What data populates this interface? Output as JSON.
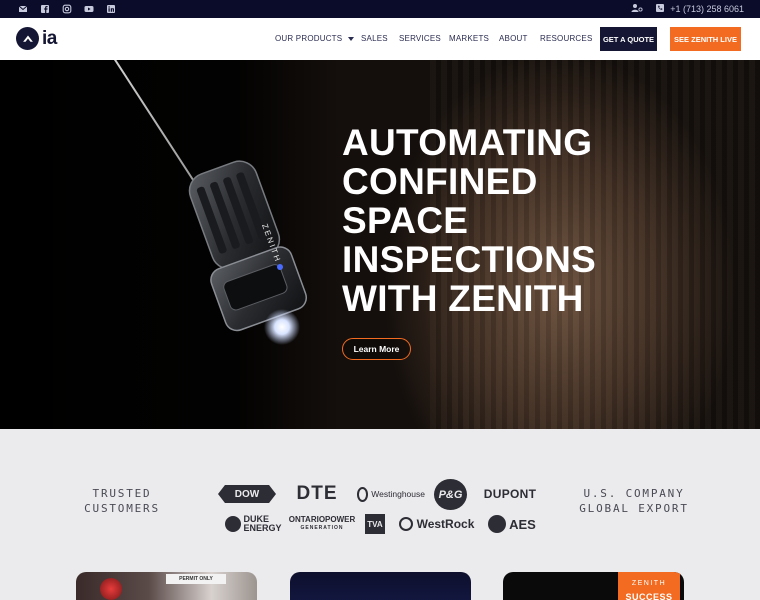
{
  "topbar": {
    "social": [
      "envelope-icon",
      "facebook-icon",
      "instagram-icon",
      "youtube-icon",
      "linkedin-icon"
    ],
    "phone": "+1 (713) 258 6061"
  },
  "nav": {
    "logo_text": "ia",
    "menu": [
      "OUR PRODUCTS",
      "SALES",
      "SERVICES",
      "MARKETS",
      "ABOUT",
      "RESOURCES"
    ],
    "quote_label": "GET A QUOTE",
    "live_label": "SEE ZENITH LIVE"
  },
  "hero": {
    "headline_lines": [
      "AUTOMATING",
      "CONFINED",
      "SPACE",
      "INSPECTIONS",
      "WITH ZENITH"
    ],
    "device_label": "ZENITH",
    "cta_label": "Learn More"
  },
  "trusted": {
    "left_label_lines": [
      "TRUSTED",
      "CUSTOMERS"
    ],
    "right_label_lines": [
      "U.S. COMPANY",
      "GLOBAL EXPORT"
    ],
    "brands_row1": [
      "DOW",
      "DTE",
      "Westinghouse",
      "P&G",
      "DUPONT"
    ],
    "brands_row2": [
      "DUKE ENERGY",
      "ONTARIOPOWER",
      "GENERATION",
      "TVA",
      "WestRock",
      "AES"
    ]
  },
  "cards": {
    "card1_sign": "PERMIT ONLY",
    "card3_brand": "ZENITH",
    "card3_label": "SUCCESS"
  },
  "colors": {
    "navy": "#141633",
    "topbar": "#0b0c2a",
    "accent_orange": "#f26b21",
    "strip_bg": "#ebebed"
  }
}
